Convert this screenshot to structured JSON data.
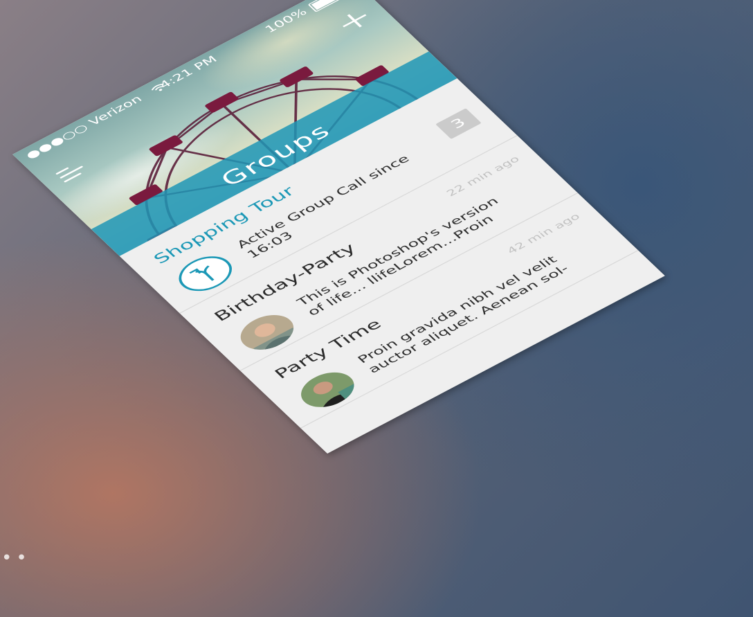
{
  "status_bar": {
    "carrier": "●●●○○ Verizon",
    "time": "4:21 PM",
    "battery": "100%"
  },
  "header": {
    "title": "Groups"
  },
  "groups": [
    {
      "name": "Shopping Tour",
      "preview": "Active Group Call since 16:03",
      "badge": "3",
      "time": ""
    },
    {
      "name": "Birthday-Party",
      "preview": "This is Photoshop's version of life... llifeLorem...Proin",
      "time": "22 min ago"
    },
    {
      "name": "Party Time",
      "preview": "Proin gravida nibh vel velit auctor aliquet. Aenean sol-",
      "time": "42 min ago"
    }
  ],
  "icons": [
    "hamburger-menu-icon",
    "plus-icon",
    "wifi-icon",
    "battery-icon",
    "call-merge-icon"
  ],
  "colors": {
    "accent": "#1b98b6",
    "background": "#efefef",
    "badge": "#cbcbcb"
  },
  "background_text": "••"
}
